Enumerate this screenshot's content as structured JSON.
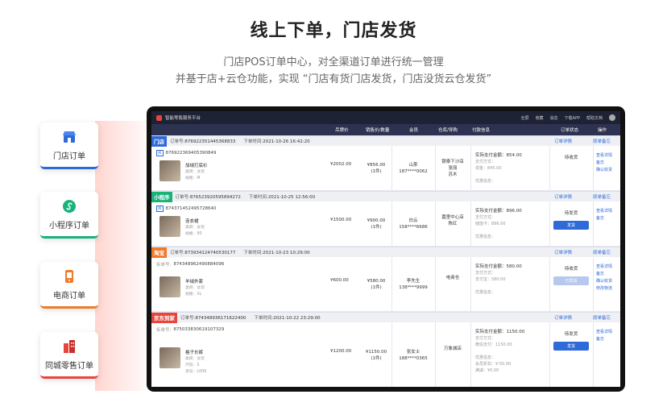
{
  "hero": {
    "title": "线上下单，门店发货",
    "subtitle1": "门店POS订单中心，对全渠道订单进行统一管理",
    "subtitle2": "并基于店+云仓功能，实现  “门店有货门店发货，门店没货云仓发货”"
  },
  "categories": [
    {
      "label": "门店订单",
      "icon": "store-icon",
      "color": "#2f6ad9"
    },
    {
      "label": "小程序订单",
      "icon": "mini-program-icon",
      "color": "#19b27a"
    },
    {
      "label": "电商订单",
      "icon": "phone-shop-icon",
      "color": "#f07a2a"
    },
    {
      "label": "同城零售订单",
      "icon": "city-building-icon",
      "color": "#e8453c"
    }
  ],
  "app": {
    "title": "智能零售服务平台",
    "toolbar": [
      "全屏",
      "收藏",
      "消息",
      "下载APP",
      "帮助文档"
    ]
  },
  "table_header": [
    "吊牌价",
    "销售价/数量",
    "会员",
    "仓库/导购",
    "付款信息",
    "订单状态",
    "操作"
  ],
  "labels": {
    "order_no": "订单号:",
    "order_time": "下单时间:",
    "split_no": "拆单号:",
    "order_detail": "订单详情",
    "order_remark": "原单备忘"
  },
  "orders": [
    {
      "channel": "门店",
      "channel_color": "#2f6ad9",
      "order_no": "876922351445368833",
      "time": "2021-10-26 16:42:20",
      "split_tag": "拆",
      "split_no": "876922369405390849",
      "product": "加绒打底衫",
      "attrs": [
        "类目：女装",
        "规格：M"
      ],
      "list_price": "¥2002.00",
      "sale_price": "¥856.00",
      "qty": "(1件)",
      "member": [
        "山茶",
        "187****0062"
      ],
      "warehouse": [
        "银泰下沙店",
        "张丽",
        "苏木"
      ],
      "pay_title": "实际支付金额：854.00",
      "pay_lines": [
        "支付方式：",
        "现金：845.00",
        "",
        "优惠信息："
      ],
      "status": "待收货",
      "button": "",
      "ops": [
        "查看详情",
        "备忘",
        "确认收货"
      ]
    },
    {
      "channel": "小程序",
      "channel_color": "#19b27a",
      "order_no": "876523920595894272",
      "time": "2021-10-25 12:56:00",
      "split_tag": "拆",
      "split_no": "874371452495728640",
      "product": "连衣裙",
      "attrs": [
        "类目：女装",
        "规格：90"
      ],
      "list_price": "¥1500.00",
      "sale_price": "¥900.00",
      "qty": "(1件)",
      "member": [
        "白云",
        "158****6686"
      ],
      "warehouse": [
        "嘉里中心店",
        "陈红"
      ],
      "pay_title": "实际支付金额：896.00",
      "pay_lines": [
        "支付方式：",
        "储值卡：896.00",
        "",
        "优惠信息："
      ],
      "status": "待发货",
      "button": "发货",
      "ops": [
        "查看详情",
        "备忘"
      ]
    },
    {
      "channel": "淘宝",
      "channel_color": "#f07a2a",
      "order_no": "873934124740530177",
      "time": "2021-10-23 10:29:00",
      "split_tag": "",
      "split_no": "874348962490884096",
      "product": "羊绒外套",
      "attrs": [
        "类目：女装",
        "规格：XL"
      ],
      "list_price": "¥600.00",
      "sale_price": "¥580.00",
      "qty": "(1件)",
      "member": [
        "李先生",
        "138****9999"
      ],
      "warehouse": [
        "电商仓"
      ],
      "pay_title": "实际支付金额：580.00",
      "pay_lines": [
        "支付方式：",
        "支付宝：580.00",
        "",
        "优惠信息："
      ],
      "status": "待收货",
      "button": "已发货",
      "ops": [
        "查看详情",
        "备忘",
        "确认收货",
        "修改物流"
      ]
    },
    {
      "channel": "京东到家",
      "channel_color": "#e8453c",
      "order_no": "874348936171622400",
      "time": "2021-10-22 23:29:00",
      "split_tag": "",
      "split_no": "875033830619107329",
      "product": "格子长裤",
      "attrs": [
        "类目：女装",
        "尺码：S",
        "货号：L009"
      ],
      "list_price": "¥1200.00",
      "sale_price": "¥1150.00",
      "qty": "(1件)",
      "member": [
        "张女士",
        "188****0365"
      ],
      "warehouse": [
        "万象城店"
      ],
      "pay_title": "实际支付金额：1150.00",
      "pay_lines": [
        "支付方式：",
        "微信支付：1150.00",
        "",
        "优惠信息：",
        "会员折扣：¥-50.00",
        "满减：¥0.00"
      ],
      "status": "待发货",
      "button": "发货",
      "ops": [
        "查看详情",
        "备忘"
      ]
    }
  ]
}
